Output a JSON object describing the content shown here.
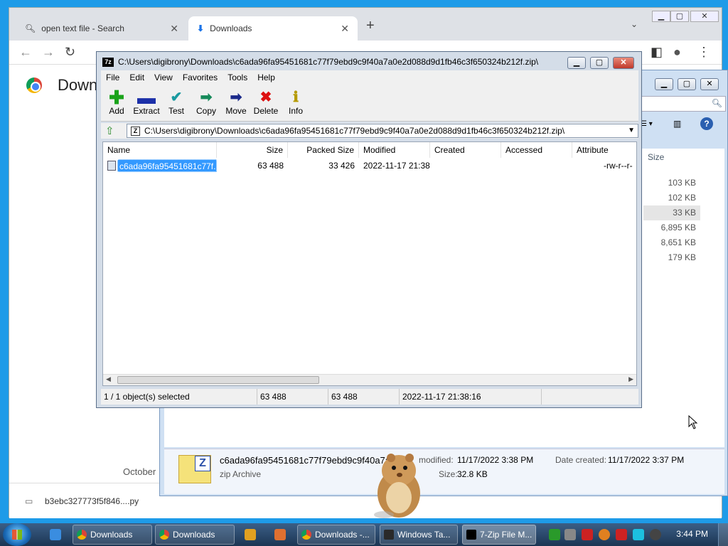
{
  "chrome": {
    "tabs": [
      {
        "label": "open text file - Search"
      },
      {
        "label": "Downloads"
      }
    ],
    "new_tab": "+",
    "page_title": "Downl",
    "date_label": "October",
    "download_bar_file": "b3ebc327773f5f846....py"
  },
  "explorer": {
    "size_header": "Size",
    "sizes": [
      "103 KB",
      "102 KB",
      "33 KB",
      "6,895 KB",
      "8,651 KB",
      "179 KB"
    ],
    "details": {
      "filename": "c6ada96fa95451681c77f79ebd9c9f40a7a",
      "type": "zip Archive",
      "modified_label": "modified:",
      "modified_value": "11/17/2022 3:38 PM",
      "created_label": "Date created:",
      "created_value": "11/17/2022 3:37 PM",
      "size_label": "Size:",
      "size_value": "32.8 KB"
    }
  },
  "sevenzip": {
    "title": "C:\\Users\\digibrony\\Downloads\\c6ada96fa95451681c77f79ebd9c9f40a7a0e2d088d9d1fb46c3f650324b212f.zip\\",
    "menu": [
      "File",
      "Edit",
      "View",
      "Favorites",
      "Tools",
      "Help"
    ],
    "toolbar": [
      "Add",
      "Extract",
      "Test",
      "Copy",
      "Move",
      "Delete",
      "Info"
    ],
    "address": "C:\\Users\\digibrony\\Downloads\\c6ada96fa95451681c77f79ebd9c9f40a7a0e2d088d9d1fb46c3f650324b212f.zip\\",
    "columns": [
      "Name",
      "Size",
      "Packed Size",
      "Modified",
      "Created",
      "Accessed",
      "Attribute"
    ],
    "rows": [
      {
        "name": "c6ada96fa95451681c77f...",
        "size": "63 488",
        "packed": "33 426",
        "modified": "2022-11-17 21:38",
        "created": "",
        "accessed": "",
        "attributes": "-rw-r--r-"
      }
    ],
    "status": {
      "selected": "1 / 1 object(s) selected",
      "size": "63 488",
      "packed": "63 488",
      "date": "2022-11-17 21:38:16"
    }
  },
  "taskbar": {
    "items": [
      "Downloads",
      "Downloads",
      "Downloads -...",
      "Windows Ta...",
      "7-Zip File M..."
    ],
    "clock": "3:44 PM"
  }
}
